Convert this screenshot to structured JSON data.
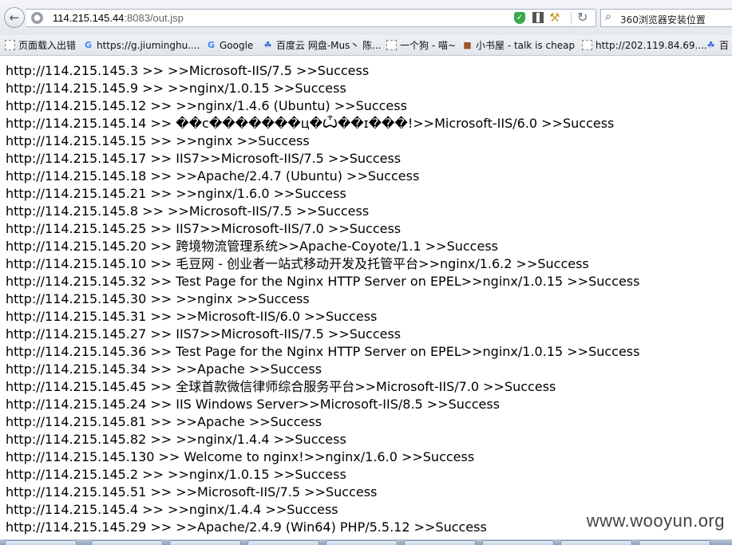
{
  "toolbar": {
    "url_host": "114.215.145.44",
    "url_rest": ":8083/out.jsp",
    "search_text": "360浏览器安装位置"
  },
  "bookmarks": [
    {
      "label": "页面载入出错",
      "icon": "page-icon"
    },
    {
      "label": "https://g.jiuminghu....",
      "icon": "google-g-icon"
    },
    {
      "label": "Google",
      "icon": "google-g-icon"
    },
    {
      "label": "百度云 网盘-Mus丶 陈...",
      "icon": "baidu-paw-icon"
    },
    {
      "label": "一个狗 - 喵~",
      "icon": "page-icon"
    },
    {
      "label": "小书屋 - talk is cheap",
      "icon": "book-icon"
    },
    {
      "label": "http://202.119.84.69....",
      "icon": "page-icon"
    },
    {
      "label": "百",
      "icon": "baidu-paw-icon"
    }
  ],
  "lines": [
    "http://114.215.145.3 >> >>Microsoft-IIS/7.5 >>Success",
    "http://114.215.145.9 >> >>nginx/1.0.15 >>Success",
    "http://114.215.145.12 >> >>nginx/1.4.6 (Ubuntu) >>Success",
    "http://114.215.145.14 >> ��c�������ц�Ѽ��ɪ���!>>Microsoft-IIS/6.0 >>Success",
    "http://114.215.145.15 >> >>nginx >>Success",
    "http://114.215.145.17 >> IIS7>>Microsoft-IIS/7.5 >>Success",
    "http://114.215.145.18 >> >>Apache/2.4.7 (Ubuntu) >>Success",
    "http://114.215.145.21 >> >>nginx/1.6.0 >>Success",
    "http://114.215.145.8 >> >>Microsoft-IIS/7.5 >>Success",
    "http://114.215.145.25 >> IIS7>>Microsoft-IIS/7.0 >>Success",
    "http://114.215.145.20 >> 跨境物流管理系统>>Apache-Coyote/1.1 >>Success",
    "http://114.215.145.10 >> 毛豆网 - 创业者一站式移动开发及托管平台>>nginx/1.6.2 >>Success",
    "http://114.215.145.32 >> Test Page for the Nginx HTTP Server on EPEL>>nginx/1.0.15 >>Success",
    "http://114.215.145.30 >> >>nginx >>Success",
    "http://114.215.145.31 >> >>Microsoft-IIS/6.0 >>Success",
    "http://114.215.145.27 >> IIS7>>Microsoft-IIS/7.5 >>Success",
    "http://114.215.145.36 >> Test Page for the Nginx HTTP Server on EPEL>>nginx/1.0.15 >>Success",
    "http://114.215.145.34 >> >>Apache >>Success",
    "http://114.215.145.45 >> 全球首款微信律师综合服务平台>>Microsoft-IIS/7.0 >>Success",
    "http://114.215.145.24 >> IIS Windows Server>>Microsoft-IIS/8.5 >>Success",
    "http://114.215.145.81 >> >>Apache >>Success",
    "http://114.215.145.82 >> >>nginx/1.4.4 >>Success",
    "http://114.215.145.130 >> Welcome to nginx!>>nginx/1.6.0 >>Success",
    "http://114.215.145.2 >> >>nginx/1.0.15 >>Success",
    "http://114.215.145.51 >> >>Microsoft-IIS/7.5 >>Success",
    "http://114.215.145.4 >> >>nginx/1.4.4 >>Success",
    "http://114.215.145.29 >> >>Apache/2.4.9 (Win64) PHP/5.5.12 >>Success"
  ],
  "watermark": "www.wooyun.org"
}
